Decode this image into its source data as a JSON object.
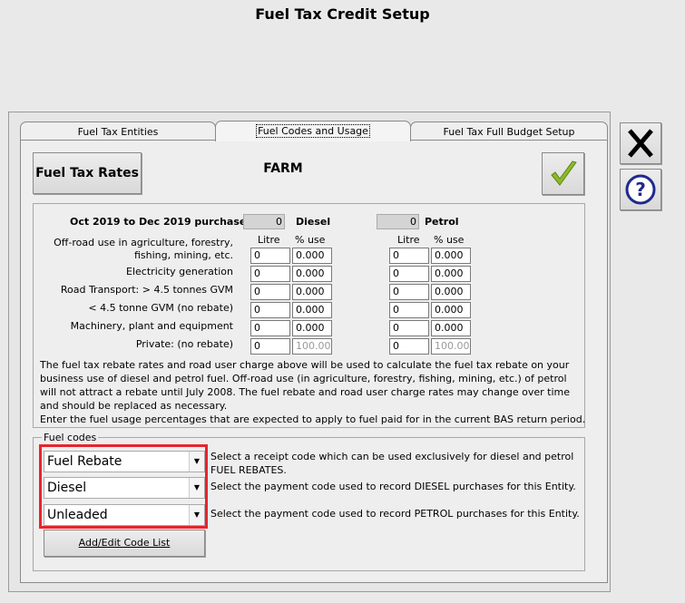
{
  "window": {
    "title": "Fuel Tax Credit Setup"
  },
  "tabs": [
    {
      "label": "Fuel Tax Entities"
    },
    {
      "label": "Fuel Codes and Usage"
    },
    {
      "label": "Fuel Tax Full Budget Setup"
    }
  ],
  "toolbar": {
    "fuel_tax_rates_label": "Fuel Tax Rates",
    "entity_name": "FARM"
  },
  "icons": {
    "ok": "check-icon",
    "close": "close-icon",
    "help": "help-icon"
  },
  "usage": {
    "period_label": "Oct 2019 to Dec 2019 purchases",
    "diesel": {
      "label": "Diesel",
      "purchases": "0"
    },
    "petrol": {
      "label": "Petrol",
      "purchases": "0"
    },
    "col_litre": "Litre",
    "col_pct": "% use",
    "rows": [
      {
        "label_line1": "Off-road use in agriculture, forestry,",
        "label_line2": "fishing, mining, etc.",
        "diesel_litre": "0",
        "diesel_pct": "0.000",
        "petrol_litre": "0",
        "petrol_pct": "0.000"
      },
      {
        "label": "Electricity generation",
        "diesel_litre": "0",
        "diesel_pct": "0.000",
        "petrol_litre": "0",
        "petrol_pct": "0.000"
      },
      {
        "label": "Road Transport: > 4.5 tonnes GVM",
        "diesel_litre": "0",
        "diesel_pct": "0.000",
        "petrol_litre": "0",
        "petrol_pct": "0.000"
      },
      {
        "label": "< 4.5 tonne GVM (no rebate)",
        "diesel_litre": "0",
        "diesel_pct": "0.000",
        "petrol_litre": "0",
        "petrol_pct": "0.000"
      },
      {
        "label": "Machinery, plant and equipment",
        "diesel_litre": "0",
        "diesel_pct": "0.000",
        "petrol_litre": "0",
        "petrol_pct": "0.000"
      },
      {
        "label": "Private: (no rebate)",
        "diesel_litre": "0",
        "diesel_pct": "100.00",
        "petrol_litre": "0",
        "petrol_pct": "100.00"
      }
    ],
    "info_lines": [
      "The fuel tax rebate rates and road user charge above will be used to calculate the fuel tax rebate on your",
      "business use of diesel and petrol fuel. Off-road use (in agriculture, forestry, fishing, mining, etc.) of petrol",
      "will not attract a rebate until July 2008. The fuel rebate and road user charge rates may change over time",
      "and should be replaced as necessary.",
      "Enter the fuel usage percentages that are expected to apply to fuel paid for in the current BAS return period."
    ]
  },
  "fuel_codes": {
    "legend": "Fuel codes",
    "rebate_code": "Fuel Rebate",
    "diesel_code": "Diesel",
    "petrol_code": "Unleaded",
    "rebate_desc_line1": "Select a receipt code which can be used exclusively for diesel and petrol",
    "rebate_desc_line2": "FUEL REBATES.",
    "diesel_desc": "Select the payment code used to record DIESEL purchases for this Entity.",
    "petrol_desc": "Select the payment code used to record PETROL purchases for this Entity.",
    "add_edit_label": "Add/Edit Code List"
  }
}
